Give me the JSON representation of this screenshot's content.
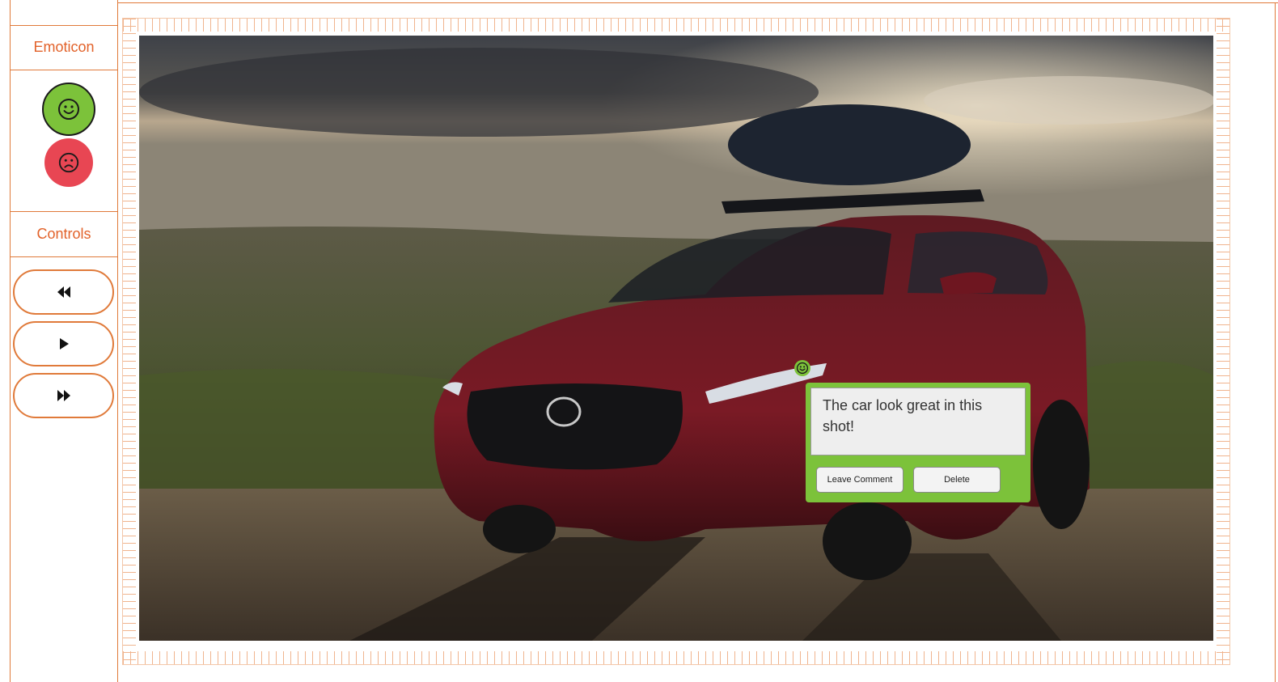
{
  "sidebar": {
    "emoticon_title": "Emoticon",
    "controls_title": "Controls",
    "emoticons": [
      {
        "name": "happy",
        "color": "#7cc23a",
        "icon": "smile-face-icon"
      },
      {
        "name": "sad",
        "color": "#e84653",
        "icon": "frown-face-icon"
      }
    ],
    "controls": [
      {
        "name": "rewind",
        "icon": "rewind-icon"
      },
      {
        "name": "play",
        "icon": "play-icon"
      },
      {
        "name": "fast-forward",
        "icon": "fast-forward-icon"
      }
    ]
  },
  "comment": {
    "text": "The car look great in this shot!",
    "leave_label": "Leave Comment",
    "delete_label": "Delete",
    "color": "#7cc23a"
  },
  "theme": {
    "accent": "#e07a3a"
  }
}
